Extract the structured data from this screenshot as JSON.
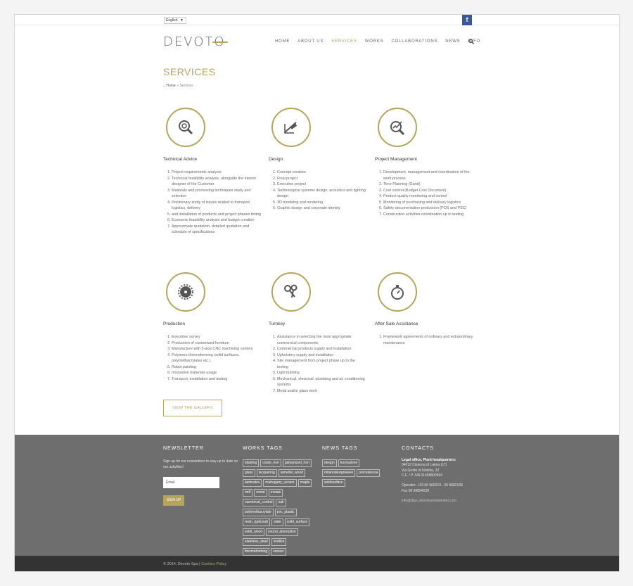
{
  "topbar": {
    "language": "English",
    "facebook": "f"
  },
  "logo": {
    "text": "DEVOTO"
  },
  "nav": {
    "items": [
      "HOME",
      "ABOUT US",
      "SERVICES",
      "WORKS",
      "COLLABORATIONS",
      "NEWS",
      "INFO"
    ],
    "active": "SERVICES"
  },
  "page": {
    "title": "SERVICES",
    "breadcrumb_home": "Home",
    "breadcrumb_sep": ">",
    "breadcrumb_current": "Services"
  },
  "services": [
    {
      "title": "Technical Advice",
      "icon": "magnifier-gears-icon",
      "items": [
        "Project requirements analysis",
        "Technical feasibility analysis, alongside the interior designer of the Customer",
        "Materials and processing techniques study and selection",
        "Preliminary study of issues related to transport logistics, delivery",
        "and installation of products and project phases timing",
        "Economic feasibility analysis and budget creation",
        "Approximate quotation, detailed quotation and schedule of specifications"
      ]
    },
    {
      "title": "Design",
      "icon": "drafting-tools-icon",
      "items": [
        "Concept creation",
        "Final project",
        "Executive project",
        "Technological systems design, acoustics and lighting design",
        "3D modeling and rendering",
        "Graphic design and corporate identity"
      ]
    },
    {
      "title": "Project Management",
      "icon": "magnifier-chart-icon",
      "items": [
        "Development, management and coordination of the work process",
        "Time Planning (Gantt)",
        "Cost control (Budget Cost Document)",
        "Product quality monitoring and control",
        "Monitoring of purchasing and delivery logistics",
        "Safety documentation production (POS and PSC)",
        "Construction activities coordination up to testing"
      ]
    },
    {
      "title": "Production",
      "icon": "saw-blade-icon",
      "items": [
        "Executive survey",
        "Production of customized furniture",
        "Manufacture with 5-axis CNC machining centers",
        "Polymers thermoforming (solid surfaces, polymethacrylates etc.)",
        "Robot painting",
        "Innovative materials usage",
        "Transport, installation and testing"
      ]
    },
    {
      "title": "Turnkey",
      "icon": "keys-icon",
      "items": [
        "Assistance in selecting the most appropriate commercial components",
        "Commercial products supply and installation",
        "Upholstery supply and installation",
        "Site management from project phase up to the testing",
        "Light building",
        "Mechanical, electrical, plumbing and air conditioning systems",
        "Metal and/or glass work"
      ]
    },
    {
      "title": "After Sale Assistance",
      "icon": "stopwatch-icon",
      "items": [
        "Framework agreements of ordinary and extraordinary maintenance"
      ]
    }
  ],
  "gallery_button": "VIEW THE GALLERY",
  "footer": {
    "newsletter_title": "NEWSLETTER",
    "newsletter_text": "Sign up for our newsletters to stay up to date on our activities!",
    "email_placeholder": "Email",
    "signup_label": "SIGN UP",
    "works_tags_title": "WORKS TAGS",
    "works_tags": [
      "blasting",
      "crude_iron",
      "galvanized_iron",
      "glass",
      "lacquering",
      "lamellar_wood",
      "laminates",
      "mahogany_veneer",
      "maple",
      "mdf",
      "metal",
      "metals",
      "numerical_control",
      "oak",
      "polymethacrylate",
      "pvc_plastic",
      "resin_(gelcoat)",
      "slate",
      "solid_surface",
      "solid_wood",
      "sound_absorption",
      "stainless_steel",
      "textiles",
      "thermoforming",
      "veneer"
    ],
    "news_tags_title": "NEWS TAGS",
    "news_tags": [
      "design",
      "fuorisalone",
      "milanodesignweek",
      "porcelanosa",
      "solidsurface"
    ],
    "contacts_title": "CONTACTS",
    "contacts": {
      "office_label": "Legal office, Plant headquarters:",
      "address1": "04012 Cisterna di Latina (LT)",
      "address2": "Via Grotte di Nottola, 32",
      "vat": "C.F. / P. IVA 01458800594",
      "phone": "Operator: +39 06 960219 - 06 9682168",
      "fax": "Fax 06 96894239",
      "email": "info@dspc.devotoarredamenti.com"
    }
  },
  "bottom": {
    "copyright": "© 2014, Devoto Spa |",
    "cookies": "Cookies Policy"
  }
}
